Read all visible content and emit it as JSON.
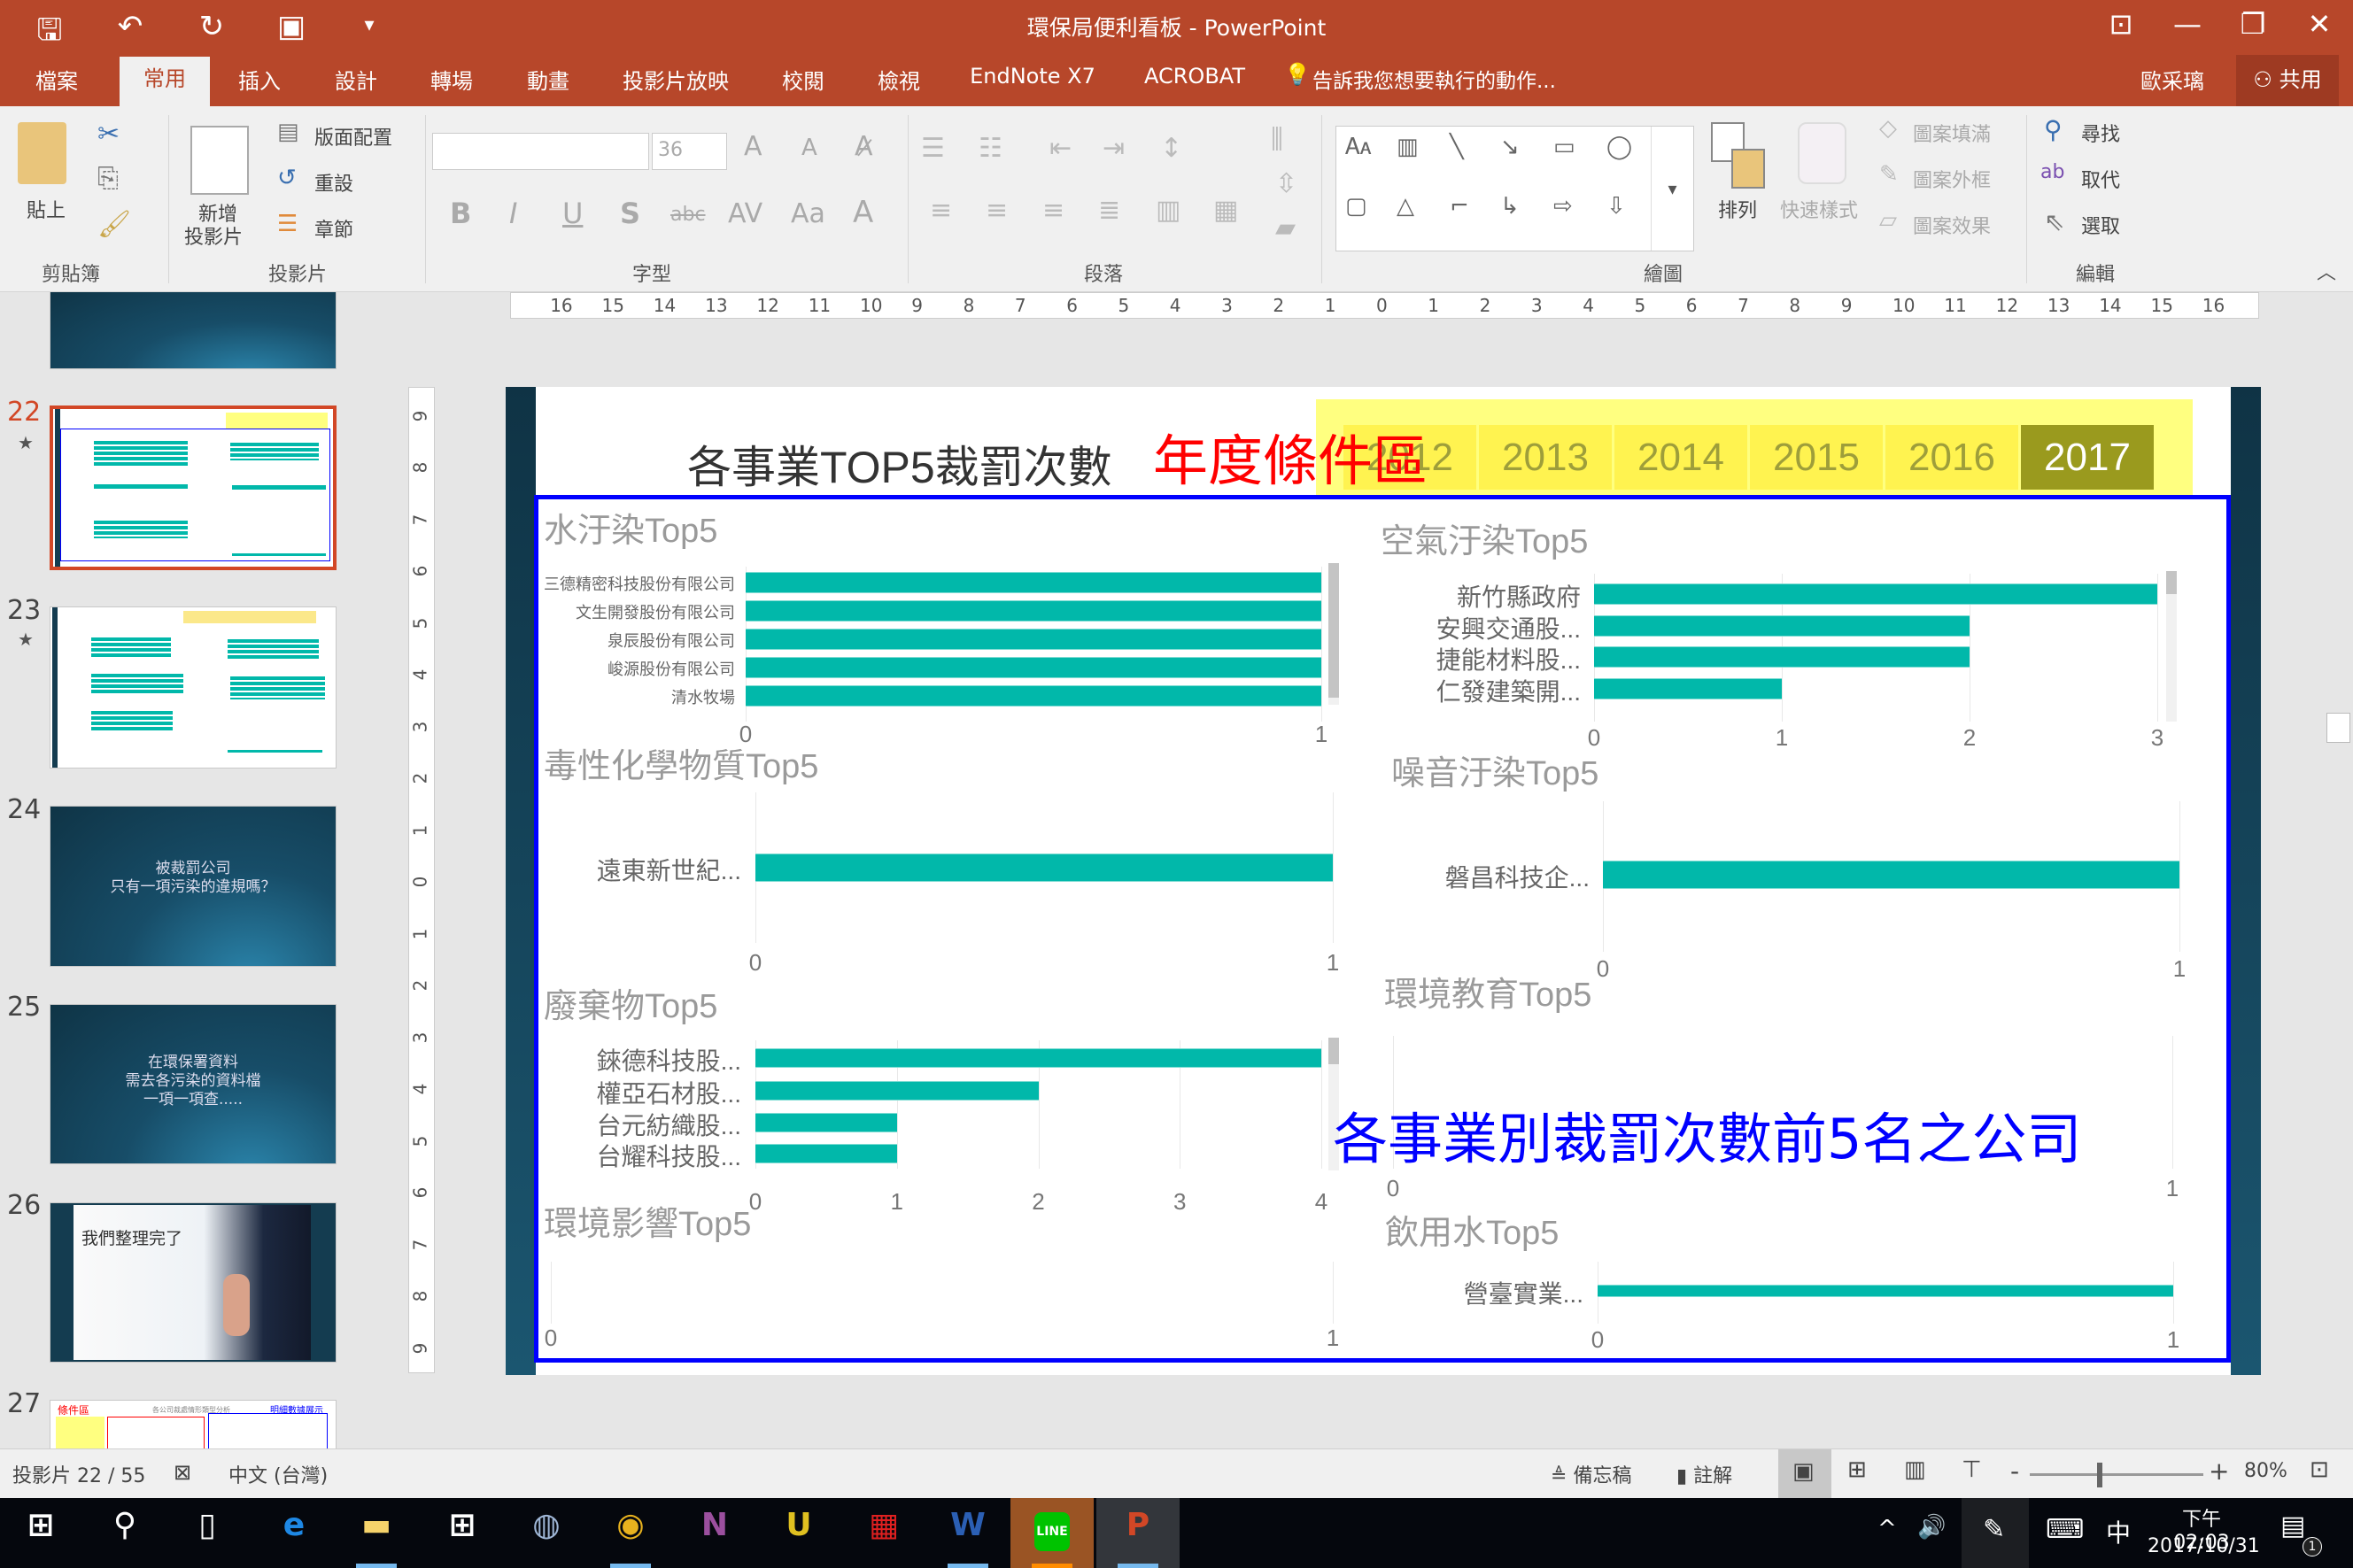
{
  "window": {
    "title": "環保局便利看板 - PowerPoint",
    "quick_access": [
      {
        "icon": "save-icon",
        "glyph": "🖫"
      },
      {
        "icon": "undo-icon",
        "glyph": "↶"
      },
      {
        "icon": "redo-icon",
        "glyph": "↻"
      },
      {
        "icon": "slideshow-from-start-icon",
        "glyph": "▣"
      },
      {
        "icon": "customize-dropdown-icon",
        "glyph": "▾"
      }
    ],
    "controls": [
      {
        "icon": "ribbon-display-options-icon",
        "glyph": "⊡"
      },
      {
        "icon": "minimize-icon",
        "glyph": "—"
      },
      {
        "icon": "restore-icon",
        "glyph": "❐"
      },
      {
        "icon": "close-icon",
        "glyph": "✕"
      }
    ]
  },
  "tabs": {
    "file": "檔案",
    "home": "常用",
    "insert": "插入",
    "design": "設計",
    "transitions": "轉場",
    "animations": "動畫",
    "slideshow": "投影片放映",
    "review": "校閱",
    "view": "檢視",
    "endnote": "EndNote X7",
    "acrobat": "ACROBAT",
    "tell_me": "告訴我您想要執行的動作...",
    "user": "歐采璃",
    "share": "共用"
  },
  "ribbon": {
    "clipboard": {
      "label": "剪貼簿",
      "paste": "貼上"
    },
    "slides": {
      "label": "投影片",
      "new_slide": "新增",
      "new_slide2": "投影片",
      "layout": "版面配置",
      "reset": "重設",
      "section": "章節"
    },
    "font": {
      "label": "字型",
      "font_name": "",
      "font_size": "36",
      "bold": "B",
      "italic": "I",
      "underline": "U",
      "shadow": "S",
      "strike": "abc",
      "spacing": "AV",
      "case": "Aa",
      "color": "A"
    },
    "paragraph": {
      "label": "段落"
    },
    "drawing": {
      "label": "繪圖",
      "arrange": "排列",
      "quick_styles": "快速樣式",
      "shape_fill": "圖案填滿",
      "shape_outline": "圖案外框",
      "shape_effects": "圖案效果"
    },
    "editing": {
      "label": "編輯",
      "find": "尋找",
      "replace": "取代",
      "select": "選取"
    }
  },
  "ruler": {
    "horizontal": [
      "16",
      "15",
      "14",
      "13",
      "12",
      "11",
      "10",
      "9",
      "8",
      "7",
      "6",
      "5",
      "4",
      "3",
      "2",
      "1",
      "0",
      "1",
      "2",
      "3",
      "4",
      "5",
      "6",
      "7",
      "8",
      "9",
      "10",
      "11",
      "12",
      "13",
      "14",
      "15",
      "16"
    ],
    "vertical": [
      "9",
      "8",
      "7",
      "6",
      "5",
      "4",
      "3",
      "2",
      "1",
      "0",
      "1",
      "2",
      "3",
      "4",
      "5",
      "6",
      "7",
      "8",
      "9"
    ]
  },
  "thumbnails": [
    {
      "number": "22",
      "selected": true
    },
    {
      "number": "23"
    },
    {
      "number": "24",
      "text": "被裁罰公司\n只有一項污染的違規嗎？"
    },
    {
      "number": "25",
      "text": "在環保署資料\n需去各污染的資料檔\n一項一項查....."
    },
    {
      "number": "26",
      "text": "我們整理完了"
    },
    {
      "number": "27",
      "text_a": "條件區",
      "text_b": "各公司裁處情形類型分析",
      "text_c": "明細數據展示"
    }
  ],
  "slide": {
    "title": "各事業TOP5裁罰次數",
    "year_filter_label": "年度條件區",
    "years": [
      "2012",
      "2013",
      "2014",
      "2015",
      "2016",
      "2017"
    ],
    "selected_year": "2017",
    "overlay_caption": "各事業別裁罰次數前5名之公司",
    "colors": {
      "bar": "#01b8aa",
      "frame": "#0000ff",
      "filter_label": "#ff0000",
      "filter_bg": "#ffff80",
      "selected_year_bg": "#9a9a1e"
    }
  },
  "chart_data": [
    {
      "type": "bar",
      "orientation": "horizontal",
      "title": "水汙染Top5",
      "categories": [
        "三德精密科技股份有限公司",
        "文生開發股份有限公司",
        "泉辰股份有限公司",
        "峻源股份有限公司",
        "清水牧場"
      ],
      "values": [
        1,
        1,
        1,
        1,
        1
      ],
      "xlim": [
        0,
        1
      ],
      "xticks": [
        "0",
        "1"
      ]
    },
    {
      "type": "bar",
      "orientation": "horizontal",
      "title": "空氣汙染Top5",
      "categories": [
        "新竹縣政府",
        "安興交通股...",
        "捷能材料股...",
        "仁發建築開..."
      ],
      "values": [
        3,
        2,
        2,
        1
      ],
      "xlim": [
        0,
        3
      ],
      "xticks": [
        "0",
        "1",
        "2",
        "3"
      ]
    },
    {
      "type": "bar",
      "orientation": "horizontal",
      "title": "毒性化學物質Top5",
      "categories": [
        "遠東新世紀..."
      ],
      "values": [
        1
      ],
      "xlim": [
        0,
        1
      ],
      "xticks": [
        "0",
        "1"
      ]
    },
    {
      "type": "bar",
      "orientation": "horizontal",
      "title": "噪音汙染Top5",
      "categories": [
        "磐昌科技企..."
      ],
      "values": [
        1
      ],
      "xlim": [
        0,
        1
      ],
      "xticks": [
        "0",
        "1"
      ]
    },
    {
      "type": "bar",
      "orientation": "horizontal",
      "title": "廢棄物Top5",
      "categories": [
        "錸德科技股...",
        "權亞石材股...",
        "台元紡織股...",
        "台耀科技股..."
      ],
      "values": [
        4,
        2,
        1,
        1
      ],
      "xlim": [
        0,
        4
      ],
      "xticks": [
        "0",
        "1",
        "2",
        "3",
        "4"
      ]
    },
    {
      "type": "bar",
      "orientation": "horizontal",
      "title": "環境教育Top5",
      "categories": [],
      "values": [],
      "xlim": [
        0,
        1
      ],
      "xticks": [
        "0",
        "1"
      ]
    },
    {
      "type": "bar",
      "orientation": "horizontal",
      "title": "環境影響Top5",
      "categories": [],
      "values": [],
      "xlim": [
        0,
        1
      ],
      "xticks": [
        "0",
        "1"
      ]
    },
    {
      "type": "bar",
      "orientation": "horizontal",
      "title": "飲用水Top5",
      "categories": [
        "營臺實業..."
      ],
      "values": [
        1
      ],
      "xlim": [
        0,
        1
      ],
      "xticks": [
        "0",
        "1"
      ]
    }
  ],
  "status": {
    "slide_indicator": "投影片 22 / 55",
    "language": "中文 (台灣)",
    "notes": "備忘稿",
    "comments": "註解",
    "zoom_minus": "-",
    "zoom_plus": "+",
    "zoom": "80%",
    "zoom_level_percent": 80
  },
  "taskbar": {
    "apps": [
      {
        "icon": "windows-start-icon",
        "glyph": "⊞",
        "color": "#ffffff"
      },
      {
        "icon": "search-icon",
        "glyph": "⚲",
        "color": "#ffffff"
      },
      {
        "icon": "task-view-icon",
        "glyph": "▯",
        "color": "#ffffff"
      },
      {
        "icon": "edge-icon",
        "glyph": "e",
        "color": "#1e88e5"
      },
      {
        "icon": "file-explorer-icon",
        "glyph": "▬",
        "color": "#f6d36b"
      },
      {
        "icon": "store-icon",
        "glyph": "⊞",
        "color": "#ffffff"
      },
      {
        "icon": "database-app-icon",
        "glyph": "◍",
        "color": "#9fb6d6"
      },
      {
        "icon": "chrome-icon",
        "glyph": "◉",
        "color": "#e8b21e"
      },
      {
        "icon": "onenote-icon",
        "glyph": "N",
        "color": "#9b4f9e"
      },
      {
        "icon": "ultraedit-icon",
        "glyph": "U",
        "color": "#e0c020"
      },
      {
        "icon": "red-grid-app-icon",
        "glyph": "▦",
        "color": "#e02020"
      },
      {
        "icon": "word-icon",
        "glyph": "W",
        "color": "#2b5fb4"
      },
      {
        "icon": "line-icon",
        "glyph": "LINE",
        "color": "#00c300"
      },
      {
        "icon": "powerpoint-icon",
        "glyph": "P",
        "color": "#d24726"
      }
    ],
    "tray": {
      "chevron": "^",
      "volume": "🔊",
      "pen": "✎",
      "keyboard": "⌨",
      "ime": "中",
      "time": "下午 02:03",
      "date": "2017/10/31",
      "notifications": "1"
    }
  }
}
